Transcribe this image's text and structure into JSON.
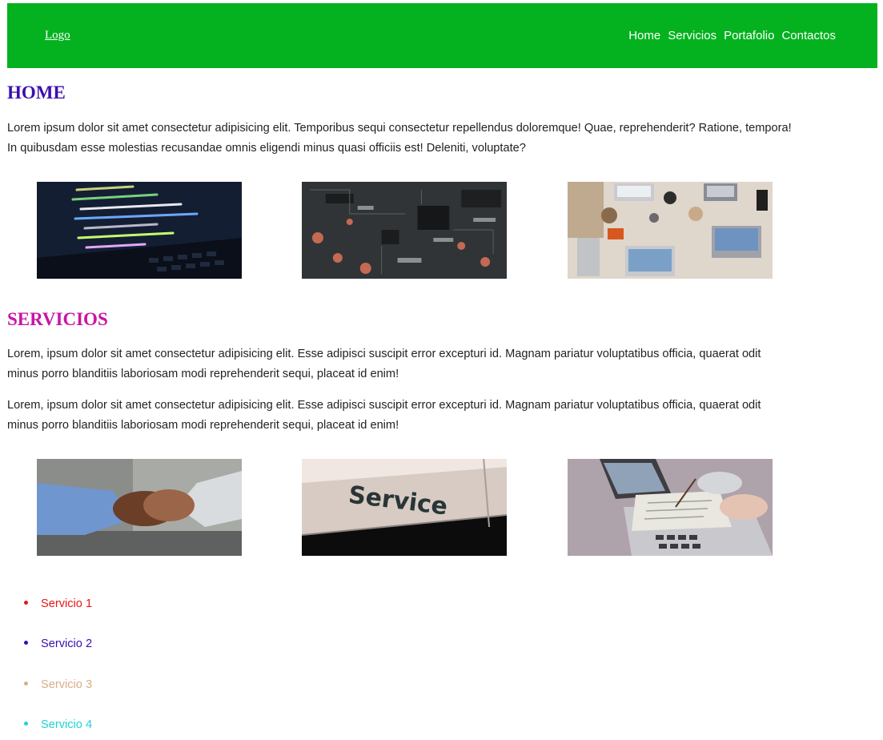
{
  "header": {
    "logo": "Logo",
    "nav": [
      "Home",
      "Servicios",
      "Portafolio",
      "Contactos"
    ],
    "bg_color": "#03b21e"
  },
  "home": {
    "title": "HOME",
    "paragraph": "Lorem ipsum dolor sit amet consectetur adipisicing elit. Temporibus sequi consectetur repellendus doloremque! Quae, reprehenderit? Ratione, tempora! In quibusdam esse molestias recusandae omnis eligendi minus quasi officiis est! Deleniti, voluptate?",
    "images": [
      "code-on-laptop-image",
      "circuit-board-image",
      "team-laptops-desk-image"
    ]
  },
  "servicios": {
    "title": "SERVICIOS",
    "paragraph1": "Lorem, ipsum dolor sit amet consectetur adipisicing elit. Esse adipisci suscipit error excepturi id. Magnam pariatur voluptatibus officia, quaerat odit minus porro blanditiis laboriosam modi reprehenderit sequi, placeat id enim!",
    "paragraph2": "Lorem, ipsum dolor sit amet consectetur adipisicing elit. Esse adipisci suscipit error excepturi id. Magnam pariatur voluptatibus officia, quaerat odit minus porro blanditiis laboriosam modi reprehenderit sequi, placeat id enim!",
    "images": [
      "handshake-image",
      "service-sign-image",
      "paperwork-laptop-image"
    ],
    "service_sign_text": "Service",
    "list": [
      {
        "label": "Servicio 1",
        "color": "#e8141b"
      },
      {
        "label": "Servicio 2",
        "color": "#3b0eb0"
      },
      {
        "label": "Servicio 3",
        "color": "#d8ae86"
      },
      {
        "label": "Servicio 4",
        "color": "#21d3d3"
      }
    ]
  }
}
